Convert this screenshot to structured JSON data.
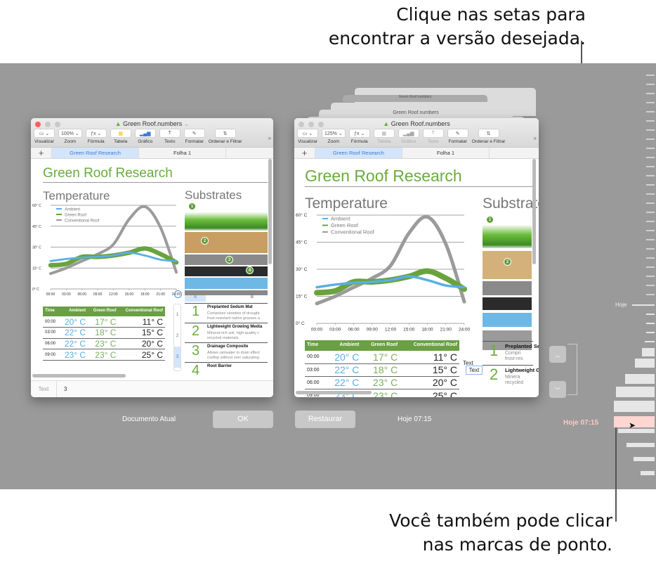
{
  "callouts": {
    "top": [
      "Clique nas setas para",
      "encontrar a versão desejada."
    ],
    "bottom": [
      "Você também pode clicar",
      "nas marcas de ponto."
    ]
  },
  "current_window": {
    "title": "Green Roof.numbers",
    "zoom": "100%",
    "toolbar": [
      {
        "icon": "view-icon",
        "label": "Visualizar",
        "enabled": true
      },
      {
        "icon": "zoom-icon",
        "label": "Zoom",
        "enabled": true
      },
      {
        "icon": "formula-icon",
        "label": "Fórmula",
        "enabled": true
      },
      {
        "icon": "table-icon",
        "label": "Tabela",
        "enabled": true
      },
      {
        "icon": "chart-icon",
        "label": "Gráfico",
        "enabled": true
      },
      {
        "icon": "text-icon",
        "label": "Texto",
        "enabled": true
      },
      {
        "icon": "format-icon",
        "label": "Formatar",
        "enabled": true
      },
      {
        "icon": "sort-filter-icon",
        "label": "Ordenar e Filtrar",
        "enabled": true
      }
    ],
    "tabs": [
      "Green Roof Research",
      "Folha 1"
    ],
    "active_tab": 0,
    "footer_label": "Text",
    "footer_value": "3",
    "column_tabs": [
      "A",
      "B"
    ],
    "row_numbers": [
      "1",
      "2",
      "3"
    ]
  },
  "version_window": {
    "title": "Green Roof.numbers",
    "zoom": "125%",
    "toolbar": [
      {
        "icon": "view-icon",
        "label": "Visualizar",
        "enabled": true
      },
      {
        "icon": "zoom-icon",
        "label": "Zoom",
        "enabled": true
      },
      {
        "icon": "formula-icon",
        "label": "Fórmula",
        "enabled": true
      },
      {
        "icon": "table-icon",
        "label": "Tabela",
        "enabled": false
      },
      {
        "icon": "chart-icon",
        "label": "Gráfico",
        "enabled": false
      },
      {
        "icon": "text-icon",
        "label": "Texto",
        "enabled": false
      },
      {
        "icon": "format-icon",
        "label": "Formatar",
        "enabled": true
      },
      {
        "icon": "sort-filter-icon",
        "label": "Ordenar e Filtrar",
        "enabled": true
      }
    ],
    "tabs": [
      "Green Roof Research",
      "Folha 1"
    ],
    "active_tab": 0,
    "text_box_labels": [
      "Text",
      "Text"
    ],
    "stacked_titles": [
      "Green Roof.numbers",
      "Green Roof.numbers",
      "Green Roof"
    ]
  },
  "document": {
    "title": "Green Roof Research",
    "section_temperature": "Temperature",
    "section_substrates": "Substrates",
    "table_headers": [
      "Time",
      "Ambient",
      "Green Roof",
      "Conventional Roof"
    ],
    "table_rows": [
      [
        "00:00",
        "20° C",
        "17° C",
        "11° C"
      ],
      [
        "03:00",
        "22° C",
        "18° C",
        "15° C"
      ],
      [
        "06:00",
        "22° C",
        "23° C",
        "20° C"
      ],
      [
        "09:00",
        "23° C",
        "23° C",
        "25° C"
      ]
    ],
    "substrates": [
      {
        "num": "1",
        "name": "Preplanted Sedum Mat",
        "desc": [
          "Comprises varieties of drought",
          "frost-resistant native grasses a"
        ]
      },
      {
        "num": "2",
        "name": "Lightweight Growing Media",
        "desc": [
          "Mineral-rich soil, high-quality c",
          "recycled materials."
        ]
      },
      {
        "num": "3",
        "name": "Drainage Composite",
        "desc": [
          "Allows rainwater to drain effect",
          "rooftop without over saturating"
        ]
      },
      {
        "num": "4",
        "name": "Root Barrier",
        "desc": []
      }
    ],
    "substrate_badges": [
      "1",
      "2",
      "3",
      "4"
    ]
  },
  "chart_data": {
    "type": "line",
    "title": "Temperature",
    "x": [
      "00:00",
      "03:00",
      "06:00",
      "09:00",
      "12:00",
      "15:00",
      "18:00",
      "21:00",
      "24:00"
    ],
    "series": [
      {
        "name": "Ambient",
        "color": "#5aaee4",
        "values": [
          20,
          21.5,
          22.5,
          23,
          24,
          26,
          24,
          21,
          20
        ]
      },
      {
        "name": "Green Roof",
        "color": "#6aa33d",
        "values": [
          17,
          18,
          23,
          23,
          24,
          26,
          29,
          25,
          19
        ]
      },
      {
        "name": "Conventional Roof",
        "color": "#9b9b9b",
        "values": [
          11,
          15,
          20,
          25,
          32,
          50,
          59,
          44,
          12
        ]
      }
    ],
    "yticks": [
      "0° C",
      "15° C",
      "30° C",
      "45° C",
      "60° C"
    ],
    "ylim": [
      0,
      60
    ],
    "xlabel": "",
    "ylabel": "",
    "legend": "top-left",
    "grid": true
  },
  "bottom_bar": {
    "current_label": "Documento Atual",
    "ok_label": "OK",
    "restore_label": "Restaurar",
    "version_time": "Hoje 07:15"
  },
  "timeline": {
    "today_label": "Hoje",
    "selected_label": "Hoje 07:15",
    "selected_color": "#ffd6d2",
    "up_arrow": "▲",
    "down_arrow": "▼"
  }
}
